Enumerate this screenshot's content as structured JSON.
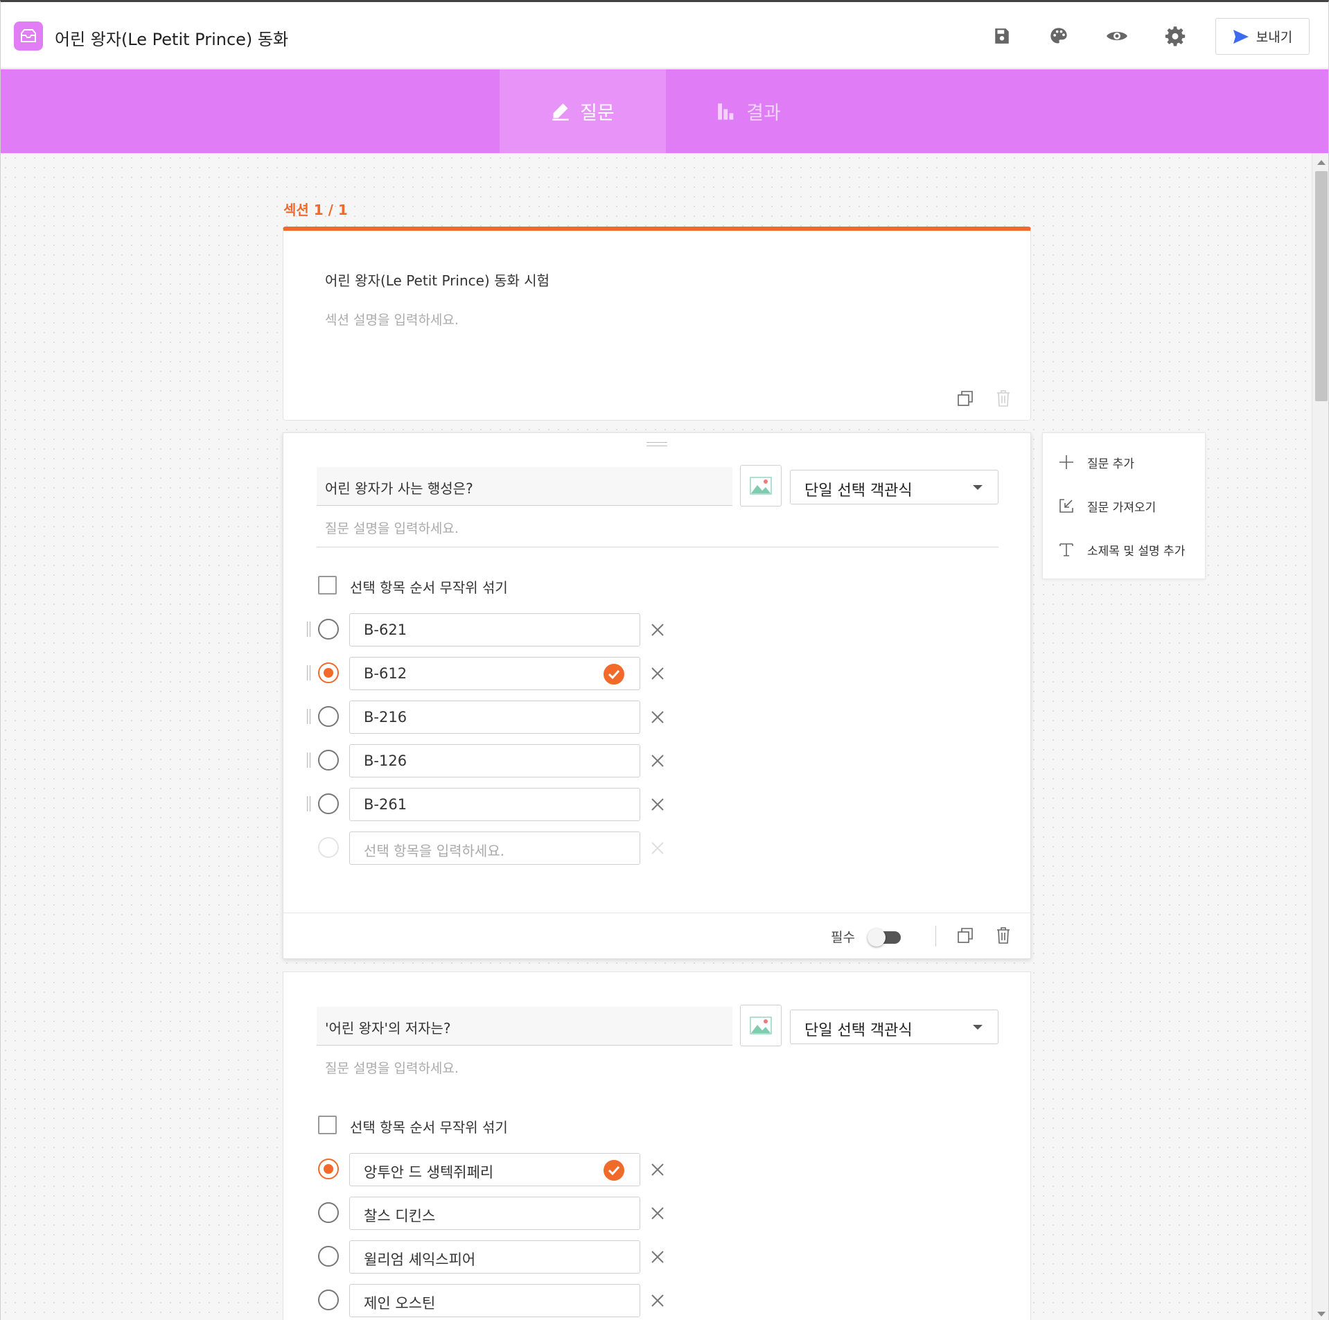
{
  "header": {
    "title": "어린 왕자(Le Petit Prince) 동화",
    "icons": [
      "save-icon",
      "palette-icon",
      "eye-icon",
      "gear-icon"
    ],
    "send_label": "보내기",
    "accent": "#e27ef5",
    "send_icon_color": "#3b6bf0"
  },
  "tabs": [
    {
      "label": "질문",
      "icon": "pencil-icon",
      "active": true
    },
    {
      "label": "결과",
      "icon": "bar-chart-icon",
      "active": false
    }
  ],
  "section": {
    "label": "섹션 1 / 1",
    "title": "어린 왕자(Le Petit Prince) 동화 시험",
    "description_placeholder": "섹션 설명을 입력하세요."
  },
  "questions": [
    {
      "title": "어린 왕자가 사는 행성은?",
      "type": "단일 선택 객관식",
      "description_placeholder": "질문 설명을 입력하세요.",
      "shuffle_label": "선택 항목 순서 무작위 섞기",
      "options": [
        {
          "label": "B-621",
          "correct": false
        },
        {
          "label": "B-612",
          "correct": true
        },
        {
          "label": "B-216",
          "correct": false
        },
        {
          "label": "B-126",
          "correct": false
        },
        {
          "label": "B-261",
          "correct": false
        }
      ],
      "new_option_placeholder": "선택 항목을 입력하세요.",
      "required_label": "필수"
    },
    {
      "title": "'어린 왕자'의 저자는?",
      "type": "단일 선택 객관식",
      "description_placeholder": "질문 설명을 입력하세요.",
      "shuffle_label": "선택 항목 순서 무작위 섞기",
      "options": [
        {
          "label": "앙투안 드 생텍쥐페리",
          "correct": true
        },
        {
          "label": "찰스 디킨스",
          "correct": false
        },
        {
          "label": "윌리엄 셰익스피어",
          "correct": false
        },
        {
          "label": "제인 오스틴",
          "correct": false
        }
      ]
    }
  ],
  "side_panel": {
    "items": [
      {
        "label": "질문 추가",
        "icon": "plus-icon"
      },
      {
        "label": "질문 가져오기",
        "icon": "import-icon"
      },
      {
        "label": "소제목 및 설명 추가",
        "icon": "text-icon"
      }
    ]
  },
  "colors": {
    "tab_band": "#df7cf6",
    "correct": "#f26a2a"
  }
}
